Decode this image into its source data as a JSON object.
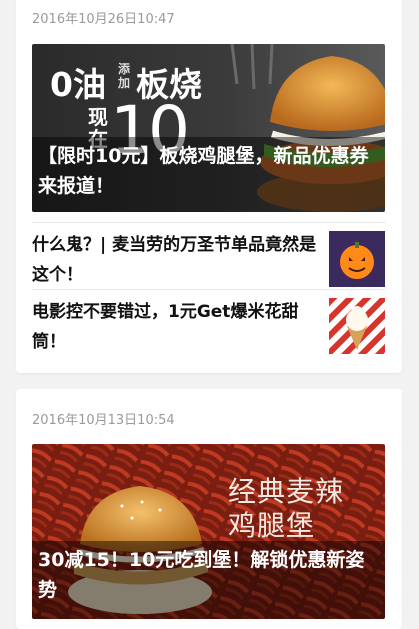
{
  "feed": {
    "articles": [
      {
        "timestamp": "2016年10月26日10:47",
        "hero": {
          "title": "【限时10元】板烧鸡腿堡，新品优惠券来报道！",
          "image_text": {
            "line1_a": "0油",
            "line1_b": "添加",
            "line1_c": "板烧",
            "line2_a": "现在",
            "line2_b": "10"
          }
        },
        "related": [
          {
            "title": "什么鬼？| 麦当劳的万圣节单品竟然是这个！",
            "thumb_icon": "halloween-pumpkin-icon"
          },
          {
            "title": "电影控不要错过，1元Get爆米花甜筒！",
            "thumb_icon": "ice-cream-cone-icon"
          }
        ]
      },
      {
        "timestamp": "2016年10月13日10:54",
        "hero": {
          "title": "30减15！10元吃到堡！解锁优惠新姿势",
          "image_text": {
            "line1": "经典麦辣",
            "line2": "鸡腿堡"
          }
        }
      }
    ]
  },
  "colors": {
    "background": "#f2f2f2",
    "card": "#ffffff",
    "timestamp": "#9a9a9a",
    "title": "#111111",
    "chili_red": "#a8321c"
  }
}
